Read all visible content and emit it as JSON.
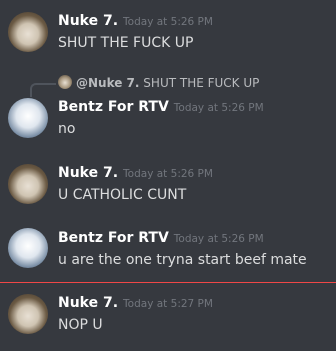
{
  "messages": [
    {
      "author": "Nuke 7.",
      "time": "Today at 5:26 PM",
      "content": "SHUT THE FUCK UP"
    },
    {
      "author": "Bentz For RTV",
      "time": "Today at 5:26 PM",
      "content": "no",
      "reply": {
        "author": "@Nuke 7.",
        "content": "SHUT THE FUCK UP"
      }
    },
    {
      "author": "Nuke 7.",
      "time": "Today at 5:26 PM",
      "content": "U CATHOLIC CUNT"
    },
    {
      "author": "Bentz For RTV",
      "time": "Today at 5:26 PM",
      "content": "u are the one tryna start beef mate"
    },
    {
      "author": "Nuke 7.",
      "time": "Today at 5:27 PM",
      "content": "NOP U"
    }
  ],
  "colors": {
    "background": "#36393f",
    "author": "#ffffff",
    "timestamp": "#72767d",
    "text": "#dcddde",
    "new_messages_divider": "#f04747"
  }
}
